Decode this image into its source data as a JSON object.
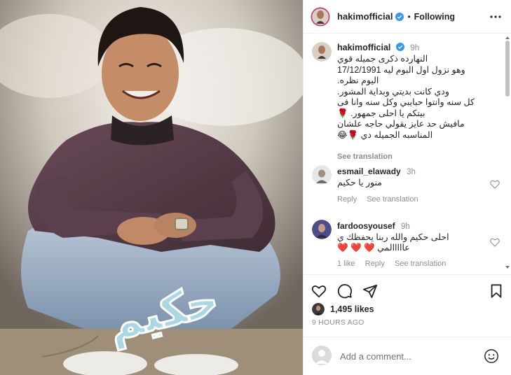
{
  "post": {
    "username": "hakimofficial",
    "follow_status": "Following",
    "logo_text": "حكيم",
    "caption": {
      "time": "9h",
      "lines": [
        "النهارده ذكرى جميله قوي",
        "وهو نزول اول البوم ليه 17/12/1991",
        "اليوم نظره.",
        "ودي كانت بديتي وبداية المشور.",
        "كل سنه وانتوا حبايبي وكل سنه وانا فى",
        "بيتكم يا احلى جمهور. 🌹",
        "مافيش حد عايز يقولي حاجه علشان",
        "المناسبه الجميله دي 🌹😂"
      ],
      "see_translation": "See translation"
    },
    "comments": [
      {
        "username": "esmail_elawady",
        "time": "3h",
        "lines": [
          "منور يا حكيم"
        ],
        "actions": [
          "Reply",
          "See translation"
        ]
      },
      {
        "username": "fardoosyousef",
        "time": "9h",
        "lines": [
          "احلى حكيم والله ربنا يحفظك ي",
          "عااااالمي ❤️ ❤️ ❤️"
        ],
        "actions": [
          "1 like",
          "Reply",
          "See translation"
        ]
      }
    ],
    "likes": "1,495 likes",
    "posted": "9 HOURS AGO",
    "add_comment_placeholder": "Add a comment..."
  },
  "icons": {
    "more": "more-horizontal-icon",
    "like": "heart-outline-icon",
    "comment": "comment-bubble-icon",
    "share": "paper-plane-icon",
    "save": "bookmark-icon",
    "emoji": "smiley-icon",
    "verified": "verified-badge-icon"
  },
  "colors": {
    "verified": "#3897f0",
    "secondary_text": "#8e8e8e",
    "divider": "#efefef",
    "heart_red": "#e0245e"
  }
}
